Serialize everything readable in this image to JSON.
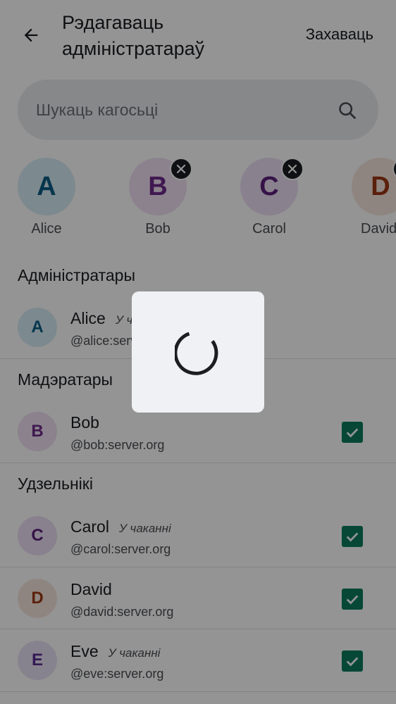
{
  "header": {
    "title": "Рэдагаваць адміністратараў",
    "save_label": "Захаваць"
  },
  "search": {
    "placeholder": "Шукаць кагосьці"
  },
  "selected_chips": [
    {
      "initial": "A",
      "name": "Alice",
      "removable": false,
      "color": "#0a5d86"
    },
    {
      "initial": "B",
      "name": "Bob",
      "removable": true,
      "color": "#6f2a8a"
    },
    {
      "initial": "C",
      "name": "Carol",
      "removable": true,
      "color": "#5d1f7c"
    },
    {
      "initial": "D",
      "name": "David",
      "removable": true,
      "color": "#9c3714"
    }
  ],
  "sections": {
    "admins": {
      "title": "Адміністратары",
      "members": [
        {
          "initial": "A",
          "name": "Alice",
          "status": "У чаканні",
          "user_id": "@alice:server.org"
        }
      ]
    },
    "moderators": {
      "title": "Мадэратары",
      "members": [
        {
          "initial": "B",
          "name": "Bob",
          "status": "",
          "user_id": "@bob:server.org",
          "checked": true
        }
      ]
    },
    "members": {
      "title": "Удзельнікі",
      "members": [
        {
          "initial": "C",
          "name": "Carol",
          "status": "У чаканні",
          "user_id": "@carol:server.org",
          "checked": true
        },
        {
          "initial": "D",
          "name": "David",
          "status": "",
          "user_id": "@david:server.org",
          "checked": true
        },
        {
          "initial": "E",
          "name": "Eve",
          "status": "У чаканні",
          "user_id": "@eve:server.org",
          "checked": true
        }
      ]
    }
  },
  "colors": {
    "checkbox": "#0c7c5c",
    "scrim": "rgba(0,0,0,0.42)",
    "dialog": "#f0f1f5"
  },
  "loading_dialog": {
    "visible": true,
    "icon": "spinner-icon"
  }
}
